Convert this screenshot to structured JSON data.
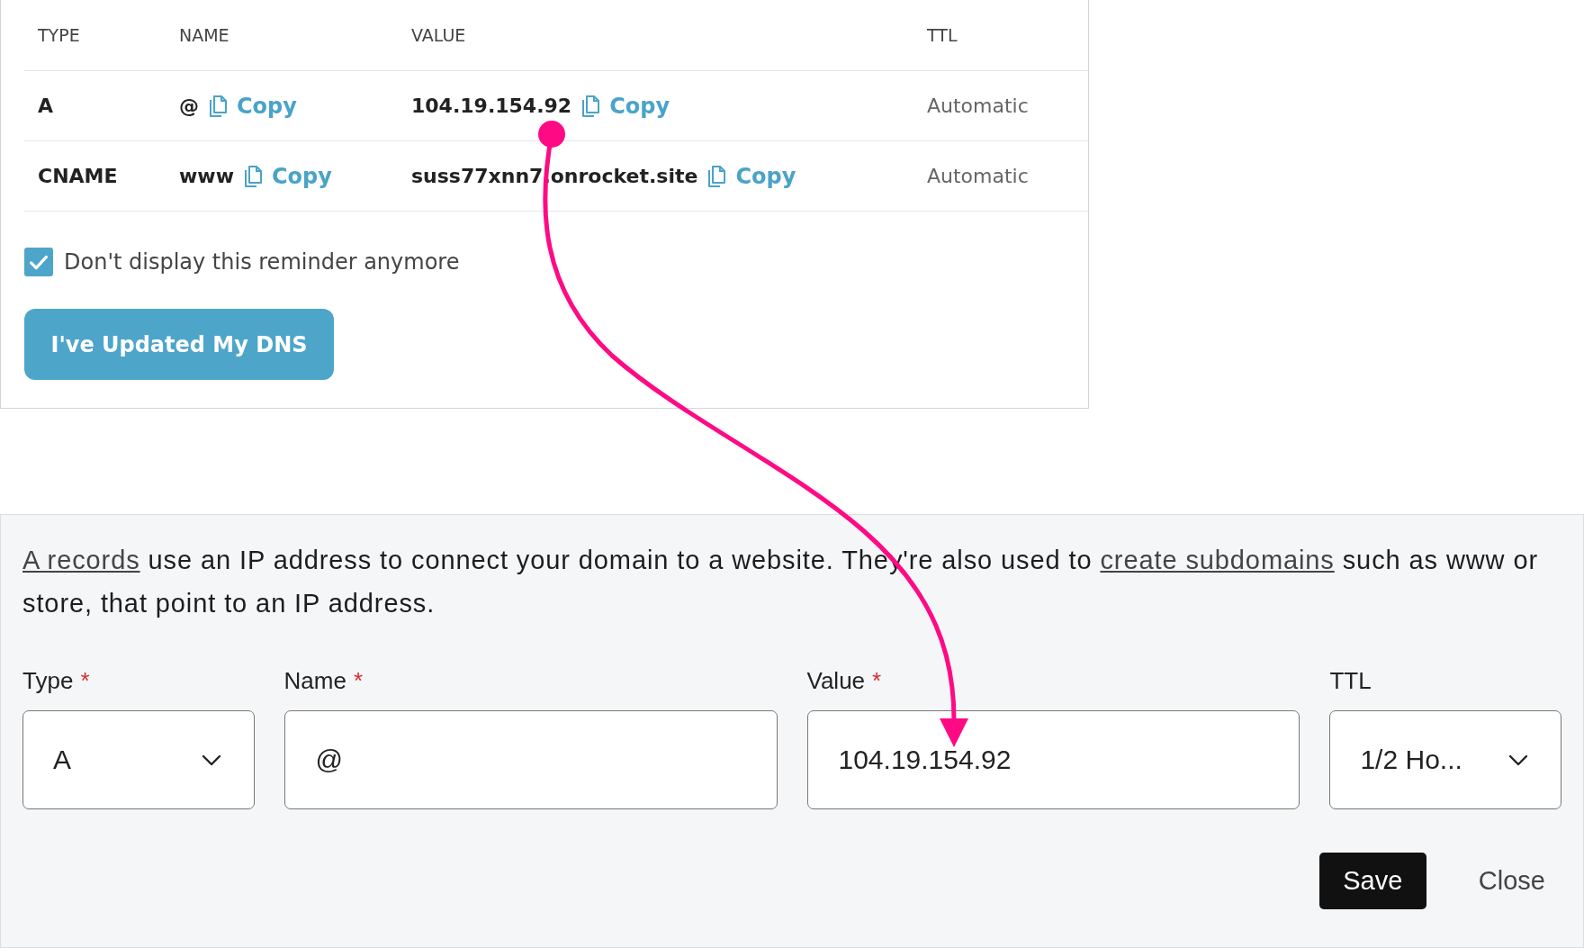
{
  "records_table": {
    "columns": [
      "TYPE",
      "NAME",
      "VALUE",
      "TTL"
    ],
    "rows": [
      {
        "type": "A",
        "name": "@",
        "name_copy": "Copy",
        "value": "104.19.154.92",
        "value_copy": "Copy",
        "ttl": "Automatic"
      },
      {
        "type": "CNAME",
        "name": "www",
        "name_copy": "Copy",
        "value": "suss77xnn7.onrocket.site",
        "value_copy": "Copy",
        "ttl": "Automatic"
      }
    ]
  },
  "reminder": {
    "label": "Don't display this reminder anymore",
    "checked": true
  },
  "updated_button": "I've Updated My DNS",
  "record_form": {
    "description": [
      {
        "text": "A records",
        "link": true
      },
      {
        "text": " use an IP address to connect your domain to a website. They're also used to ",
        "link": false
      },
      {
        "text": "create subdomains",
        "link": true
      },
      {
        "text": " such as www or store, that point to an IP address.",
        "link": false
      }
    ],
    "fields": [
      {
        "kind": "select",
        "label": "Type",
        "required_mark": "*",
        "value": "A"
      },
      {
        "kind": "text",
        "label": "Name",
        "required_mark": "*",
        "value": "@"
      },
      {
        "kind": "text",
        "label": "Value",
        "required_mark": "*",
        "value": "104.19.154.92"
      },
      {
        "kind": "select",
        "label": "TTL",
        "value": "1/2 Ho..."
      }
    ],
    "buttons": [
      {
        "label": "Save",
        "kind": "primary"
      },
      {
        "label": "Close",
        "kind": "plain"
      }
    ]
  }
}
